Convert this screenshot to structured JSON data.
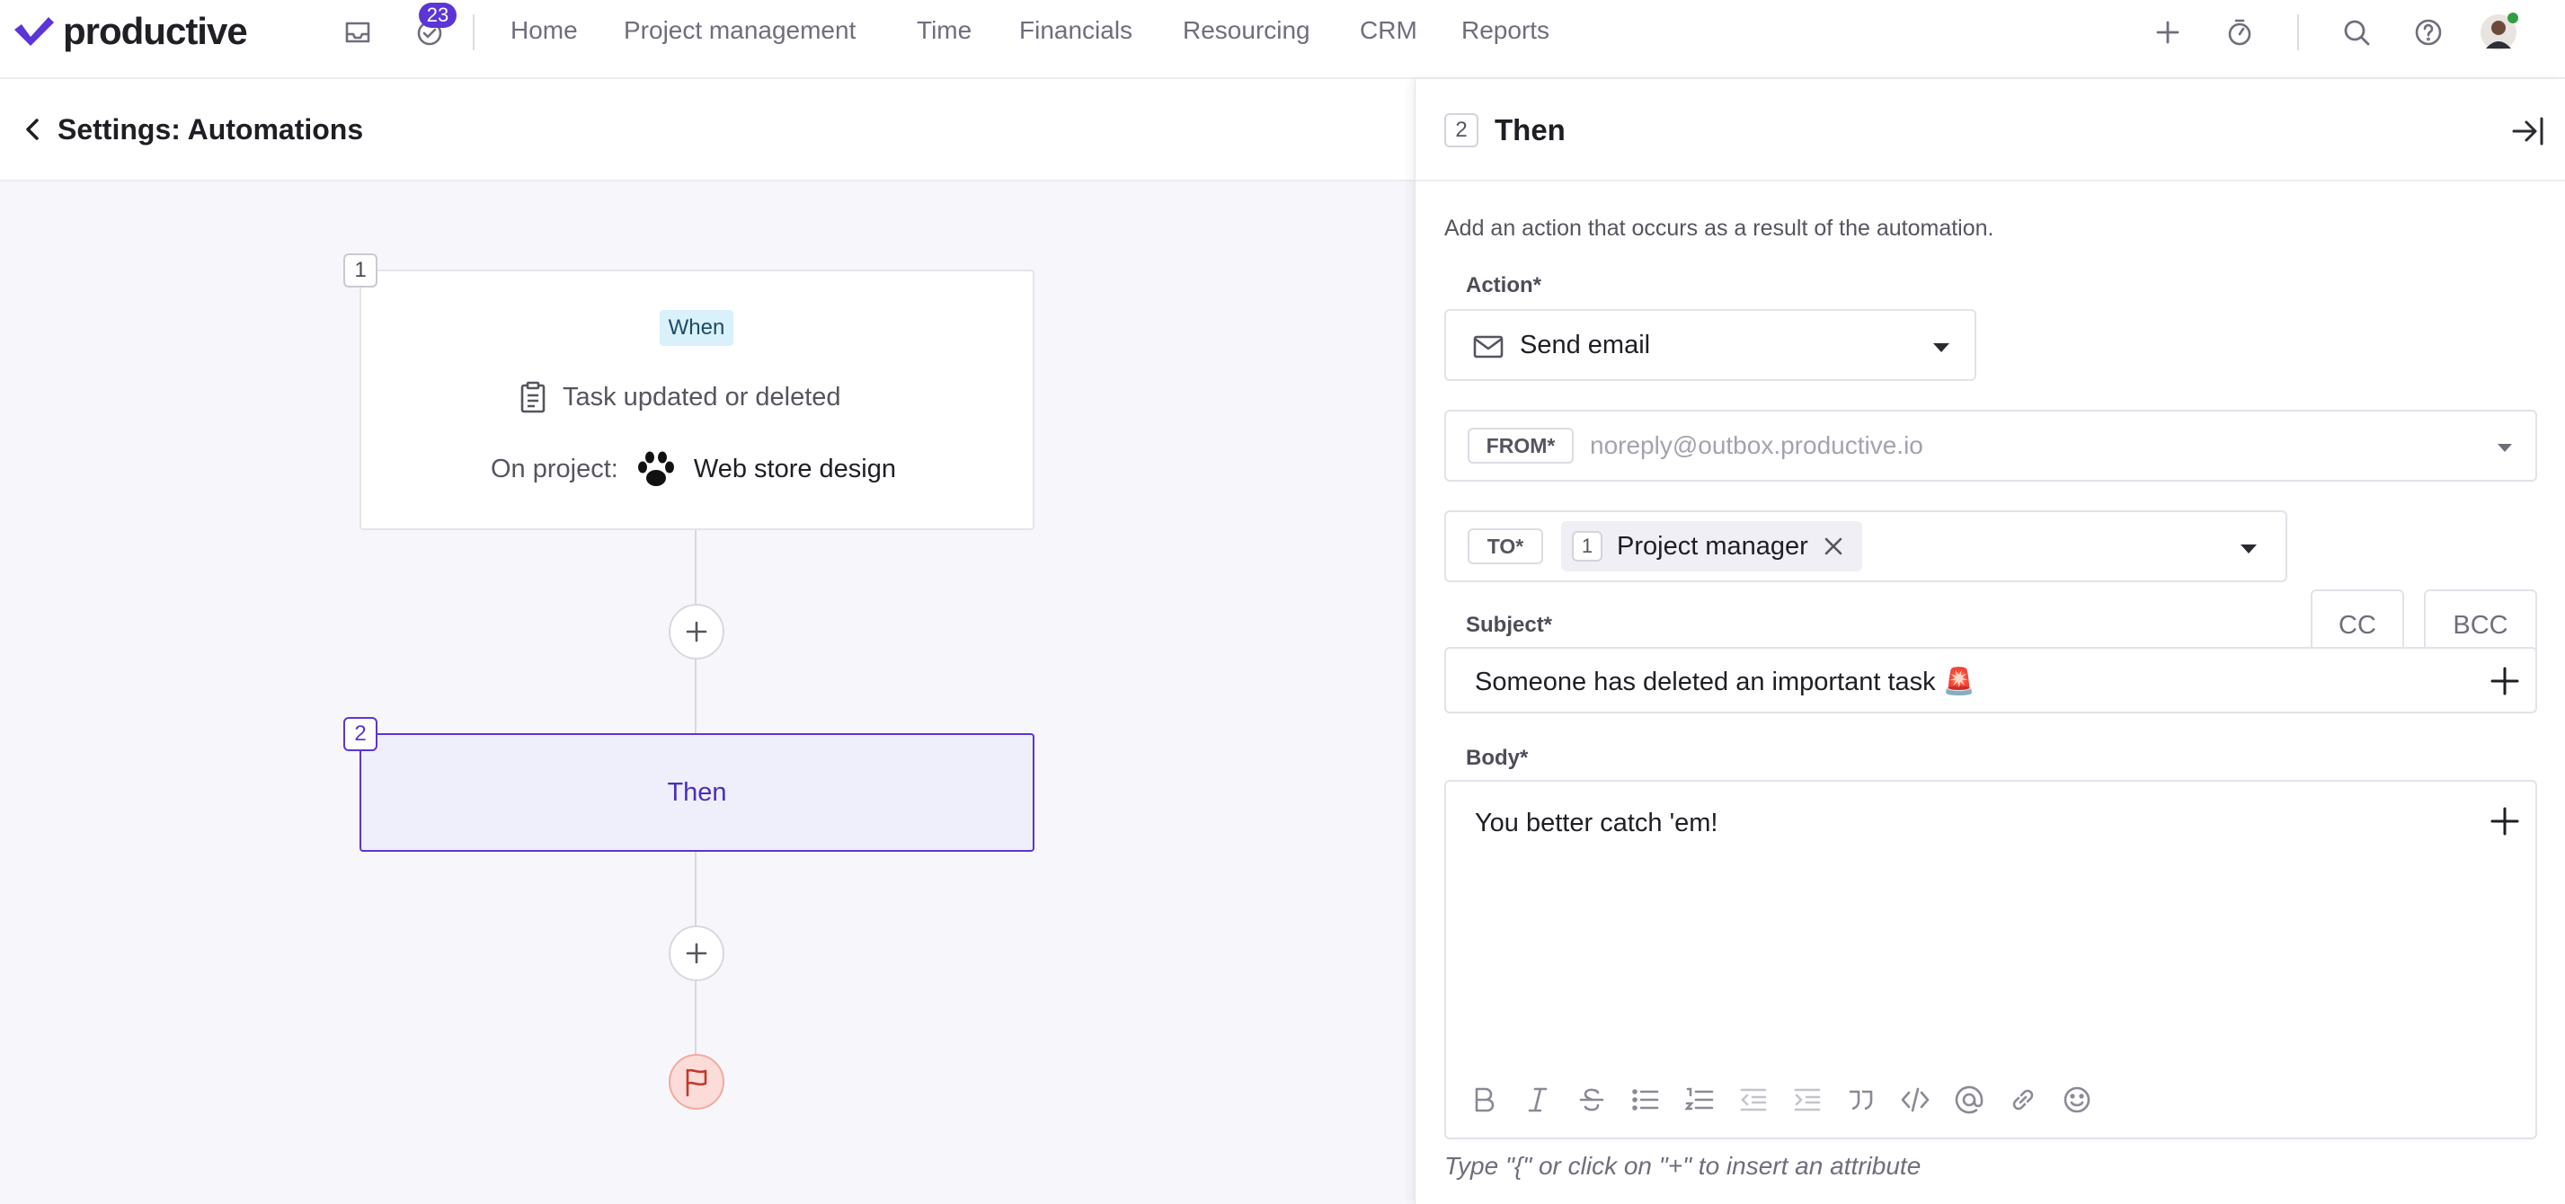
{
  "brand": {
    "name": "productive",
    "accent": "#5b35d5"
  },
  "topnav": {
    "notification_count": "23",
    "items": [
      "Home",
      "Project management",
      "Time",
      "Financials",
      "Resourcing",
      "CRM",
      "Reports"
    ]
  },
  "page": {
    "title": "Settings: Automations"
  },
  "flow": {
    "trigger": {
      "step": "1",
      "badge": "When",
      "event": "Task updated or deleted",
      "project_label": "On project:",
      "project_name": "Web store design"
    },
    "action": {
      "step": "2",
      "label": "Then"
    }
  },
  "panel": {
    "step": "2",
    "title": "Then",
    "description": "Add an action that occurs as a result of the automation.",
    "action_label": "Action*",
    "action_value": "Send email",
    "from_label": "FROM*",
    "from_value": "noreply@outbox.productive.io",
    "to_label": "TO*",
    "to_recipient": {
      "count": "1",
      "name": "Project manager"
    },
    "cc_label": "CC",
    "bcc_label": "BCC",
    "subject_label": "Subject*",
    "subject_value": "Someone has deleted an important task 🚨",
    "body_label": "Body*",
    "body_value": "You better catch 'em!",
    "hint": "Type \"{\" or click on \"+\" to insert an attribute"
  }
}
